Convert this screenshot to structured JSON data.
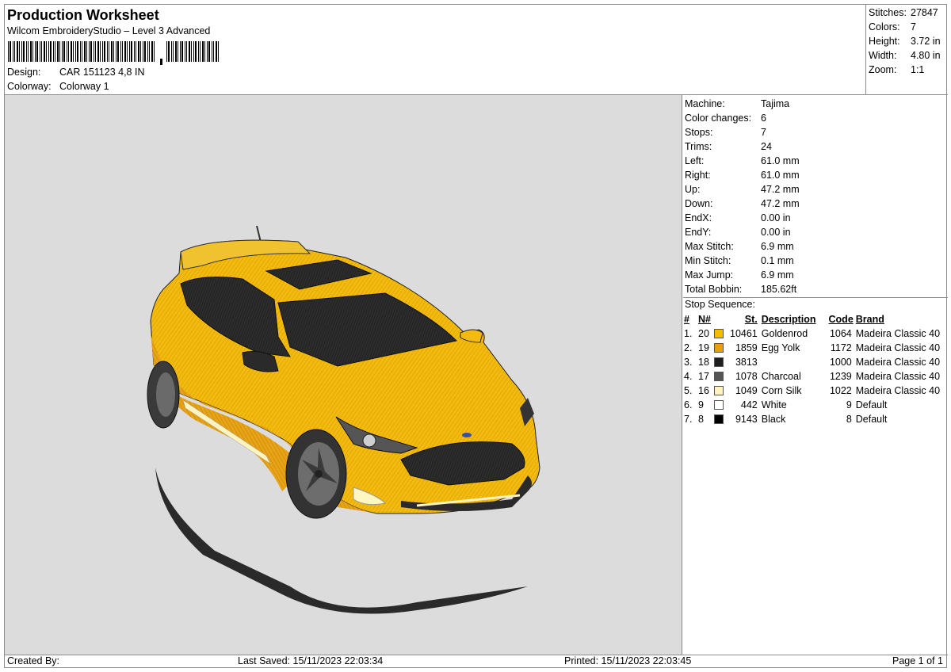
{
  "header": {
    "title": "Production Worksheet",
    "subtitle": "Wilcom EmbroideryStudio – Level 3 Advanced",
    "design_label": "Design:",
    "design_value": "CAR 151123 4,8 IN",
    "colorway_label": "Colorway:",
    "colorway_value": "Colorway 1"
  },
  "summary": [
    {
      "label": "Stitches:",
      "value": "27847"
    },
    {
      "label": "Colors:",
      "value": "7"
    },
    {
      "label": "Height:",
      "value": "3.72 in"
    },
    {
      "label": "Width:",
      "value": "4.80 in"
    },
    {
      "label": "Zoom:",
      "value": "1:1"
    }
  ],
  "machine_info": [
    {
      "label": "Machine:",
      "value": "Tajima"
    },
    {
      "label": "Color changes:",
      "value": "6"
    },
    {
      "label": "Stops:",
      "value": "7"
    },
    {
      "label": "Trims:",
      "value": "24"
    },
    {
      "label": "Left:",
      "value": "61.0 mm"
    },
    {
      "label": "Right:",
      "value": "61.0 mm"
    },
    {
      "label": "Up:",
      "value": "47.2 mm"
    },
    {
      "label": "Down:",
      "value": "47.2 mm"
    },
    {
      "label": "EndX:",
      "value": "0.00 in"
    },
    {
      "label": "EndY:",
      "value": "0.00 in"
    },
    {
      "label": "Max Stitch:",
      "value": "6.9 mm"
    },
    {
      "label": "Min Stitch:",
      "value": "0.1 mm"
    },
    {
      "label": "Max Jump:",
      "value": "6.9 mm"
    },
    {
      "label": "Total Bobbin:",
      "value": "185.62ft"
    }
  ],
  "stop_sequence": {
    "title": "Stop Sequence:",
    "columns": [
      "#",
      "N#",
      "St.",
      "Description",
      "Code",
      "Brand"
    ],
    "rows": [
      {
        "idx": "1.",
        "n": "20",
        "color": "#f5bd00",
        "st": "10461",
        "desc": "Goldenrod",
        "code": "1064",
        "brand": "Madeira Classic 40"
      },
      {
        "idx": "2.",
        "n": "19",
        "color": "#e8a010",
        "st": "1859",
        "desc": "Egg Yolk",
        "code": "1172",
        "brand": "Madeira Classic 40"
      },
      {
        "idx": "3.",
        "n": "18",
        "color": "#1e1e1e",
        "st": "3813",
        "desc": "",
        "code": "1000",
        "brand": "Madeira Classic 40"
      },
      {
        "idx": "4.",
        "n": "17",
        "color": "#555555",
        "st": "1078",
        "desc": "Charcoal",
        "code": "1239",
        "brand": "Madeira Classic 40"
      },
      {
        "idx": "5.",
        "n": "16",
        "color": "#fff3c0",
        "st": "1049",
        "desc": "Corn Silk",
        "code": "1022",
        "brand": "Madeira Classic 40"
      },
      {
        "idx": "6.",
        "n": "9",
        "color": "#ffffff",
        "st": "442",
        "desc": "White",
        "code": "9",
        "brand": "Default"
      },
      {
        "idx": "7.",
        "n": "8",
        "color": "#000000",
        "st": "9143",
        "desc": "Black",
        "code": "8",
        "brand": "Default"
      }
    ]
  },
  "footer": {
    "created_by": "Created By:",
    "last_saved": "Last Saved: 15/11/2023 22:03:34",
    "printed": "Printed: 15/11/2023 22:03:45",
    "page": "Page 1 of 1"
  },
  "preview": {
    "background": "#dcdcdc",
    "body_color": "#f5bd00"
  }
}
